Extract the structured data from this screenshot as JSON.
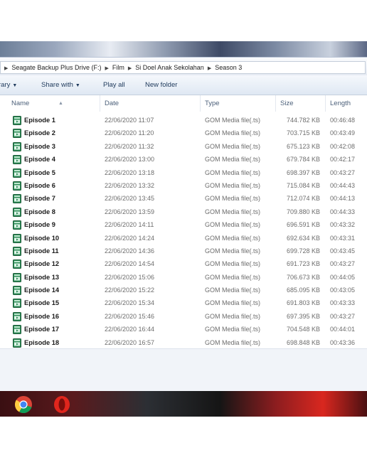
{
  "breadcrumb": [
    "Seagate Backup Plus Drive (F:)",
    "Film",
    "Si Doel Anak Sekolahan",
    "Season 3"
  ],
  "toolbar": {
    "library_label": "rary",
    "share_label": "Share with",
    "play_label": "Play all",
    "new_folder_label": "New folder"
  },
  "columns": {
    "name": "Name",
    "date": "Date",
    "type": "Type",
    "size": "Size",
    "length": "Length"
  },
  "files": [
    {
      "name": "Episode 1",
      "date": "22/06/2020 11:07",
      "type": "GOM Media file(.ts)",
      "size": "744.782 KB",
      "length": "00:46:48"
    },
    {
      "name": "Episode 2",
      "date": "22/06/2020 11:20",
      "type": "GOM Media file(.ts)",
      "size": "703.715 KB",
      "length": "00:43:49"
    },
    {
      "name": "Episode 3",
      "date": "22/06/2020 11:32",
      "type": "GOM Media file(.ts)",
      "size": "675.123 KB",
      "length": "00:42:08"
    },
    {
      "name": "Episode 4",
      "date": "22/06/2020 13:00",
      "type": "GOM Media file(.ts)",
      "size": "679.784 KB",
      "length": "00:42:17"
    },
    {
      "name": "Episode 5",
      "date": "22/06/2020 13:18",
      "type": "GOM Media file(.ts)",
      "size": "698.397 KB",
      "length": "00:43:27"
    },
    {
      "name": "Episode 6",
      "date": "22/06/2020 13:32",
      "type": "GOM Media file(.ts)",
      "size": "715.084 KB",
      "length": "00:44:43"
    },
    {
      "name": "Episode 7",
      "date": "22/06/2020 13:45",
      "type": "GOM Media file(.ts)",
      "size": "712.074 KB",
      "length": "00:44:13"
    },
    {
      "name": "Episode 8",
      "date": "22/06/2020 13:59",
      "type": "GOM Media file(.ts)",
      "size": "709.880 KB",
      "length": "00:44:33"
    },
    {
      "name": "Episode 9",
      "date": "22/06/2020 14:11",
      "type": "GOM Media file(.ts)",
      "size": "696.591 KB",
      "length": "00:43:32"
    },
    {
      "name": "Episode 10",
      "date": "22/06/2020 14:24",
      "type": "GOM Media file(.ts)",
      "size": "692.634 KB",
      "length": "00:43:31"
    },
    {
      "name": "Episode 11",
      "date": "22/06/2020 14:36",
      "type": "GOM Media file(.ts)",
      "size": "699.728 KB",
      "length": "00:43:45"
    },
    {
      "name": "Episode 12",
      "date": "22/06/2020 14:54",
      "type": "GOM Media file(.ts)",
      "size": "691.723 KB",
      "length": "00:43:27"
    },
    {
      "name": "Episode 13",
      "date": "22/06/2020 15:06",
      "type": "GOM Media file(.ts)",
      "size": "706.673 KB",
      "length": "00:44:05"
    },
    {
      "name": "Episode 14",
      "date": "22/06/2020 15:22",
      "type": "GOM Media file(.ts)",
      "size": "685.095 KB",
      "length": "00:43:05"
    },
    {
      "name": "Episode 15",
      "date": "22/06/2020 15:34",
      "type": "GOM Media file(.ts)",
      "size": "691.803 KB",
      "length": "00:43:33"
    },
    {
      "name": "Episode 16",
      "date": "22/06/2020 15:46",
      "type": "GOM Media file(.ts)",
      "size": "697.395 KB",
      "length": "00:43:27"
    },
    {
      "name": "Episode 17",
      "date": "22/06/2020 16:44",
      "type": "GOM Media file(.ts)",
      "size": "704.548 KB",
      "length": "00:44:01"
    },
    {
      "name": "Episode 18",
      "date": "22/06/2020 16:57",
      "type": "GOM Media file(.ts)",
      "size": "698.848 KB",
      "length": "00:43:36"
    }
  ],
  "icons": {
    "file_icon": "video-file-icon",
    "taskbar": [
      "chrome-icon",
      "opera-icon"
    ]
  },
  "colors": {
    "link_text": "#1e395b",
    "name_text": "#1b1b1b",
    "meta_text": "#6d6d6d",
    "file_icon_green": "#2e8b57"
  }
}
